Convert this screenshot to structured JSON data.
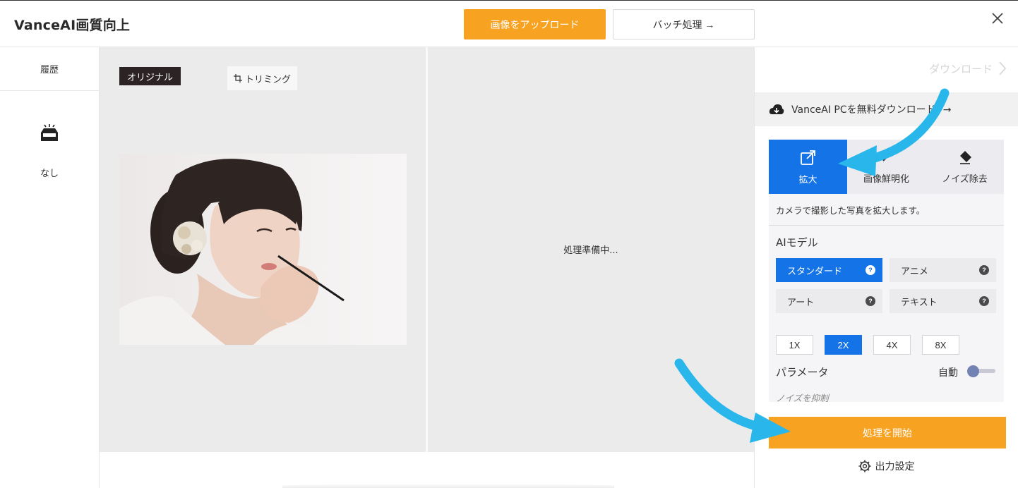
{
  "header": {
    "app_title": "VanceAI画質向上",
    "upload_label": "画像をアップロード",
    "batch_label": "バッチ処理 →"
  },
  "sidebar": {
    "history_label": "履歴",
    "empty_label": "なし"
  },
  "original_panel": {
    "tag_label": "オリジナル",
    "trim_label": "トリミング"
  },
  "result_panel": {
    "status_text": "処理準備中..."
  },
  "right_panel": {
    "download_label": "ダウンロード",
    "pc_banner_label": "VanceAI PCを無料ダウンロード! →",
    "modes": [
      {
        "label": "拡大",
        "icon": "enlarge-icon",
        "active": true
      },
      {
        "label": "画像鮮明化",
        "icon": "sharpen-icon",
        "active": false
      },
      {
        "label": "ノイズ除去",
        "icon": "eraser-icon",
        "active": false
      }
    ],
    "mode_description": "カメラで撮影した写真を拡大します。",
    "ai_model_title": "AIモデル",
    "models": [
      {
        "label": "スタンダード",
        "active": true
      },
      {
        "label": "アニメ",
        "active": false
      },
      {
        "label": "アート",
        "active": false
      },
      {
        "label": "テキスト",
        "active": false
      }
    ],
    "scales": [
      {
        "label": "1X",
        "active": false
      },
      {
        "label": "2X",
        "active": true
      },
      {
        "label": "4X",
        "active": false
      },
      {
        "label": "8X",
        "active": false
      }
    ],
    "parameter_title": "パラメータ",
    "auto_label": "自動",
    "auto_enabled": false,
    "noise_suppress_label": "ノイズを抑制",
    "start_label": "処理を開始",
    "output_settings_label": "出力設定"
  },
  "colors": {
    "accent_orange": "#f7a221",
    "accent_blue": "#1473e6",
    "annotation_arrow": "#29b6ea"
  }
}
